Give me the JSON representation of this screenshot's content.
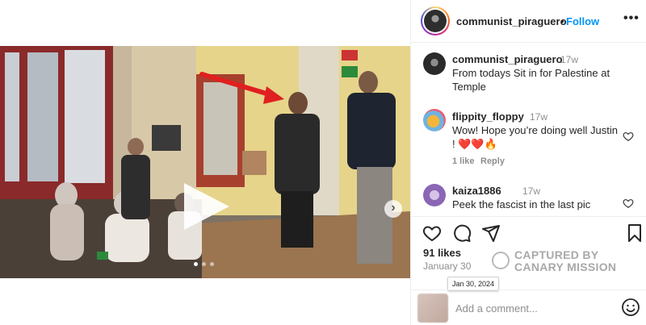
{
  "post": {
    "author": "communist_piraguero",
    "follow_label": "Follow",
    "separator": "•",
    "more_label": "•••"
  },
  "media": {
    "next_label": "›",
    "slide_count": 3,
    "active_slide": 1
  },
  "comments": [
    {
      "user": "communist_piraguero",
      "time": "17w",
      "lines": [
        "From todays Sit in for Palestine at",
        "Temple"
      ]
    },
    {
      "user": "flippity_floppy",
      "time": "17w",
      "lines": [
        "Wow! Hope you’re doing well Justin",
        "! ❤️❤️🔥"
      ],
      "likes_label": "1 like",
      "reply_label": "Reply"
    },
    {
      "user": "kaiza1886",
      "time": "17w",
      "lines": [
        "Peek the fascist in the last pic"
      ]
    }
  ],
  "stats": {
    "likes": "91 likes",
    "date": "January 30",
    "tooltip": "Jan 30, 2024"
  },
  "watermark": {
    "line1": "CAPTURED BY",
    "line2": "CANARY MISSION"
  },
  "composer": {
    "placeholder": "Add a comment..."
  },
  "colors": {
    "accent": "#0095f6",
    "text": "#262626",
    "muted": "#8e8e8e",
    "heart_red": "#ed4956"
  },
  "icons": [
    "heart-icon",
    "comment-icon",
    "share-icon",
    "bookmark-icon",
    "play-icon",
    "next-arrow-icon",
    "mute-icon",
    "emoji-icon"
  ]
}
